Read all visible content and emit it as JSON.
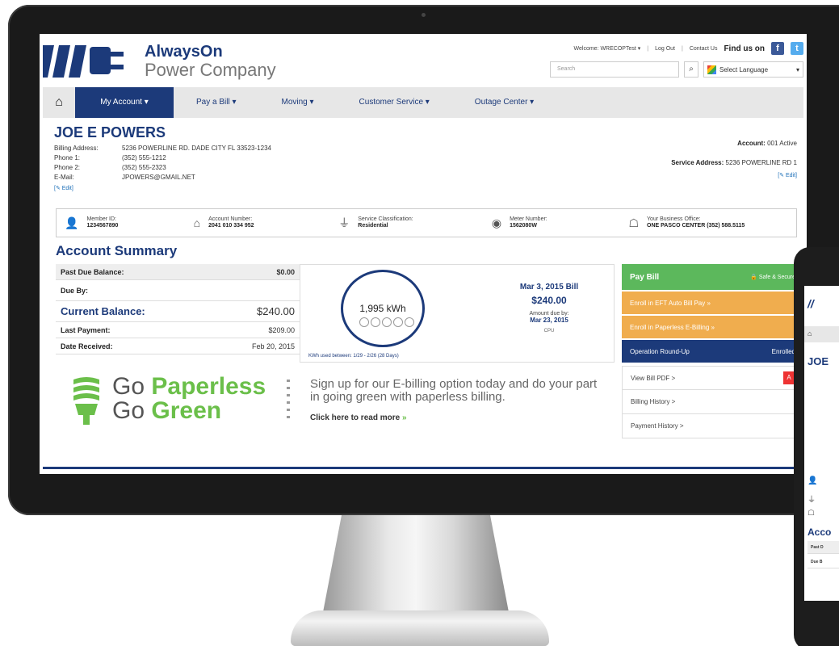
{
  "brand": {
    "name": "AlwaysOn",
    "sub": "Power Company"
  },
  "toplinks": {
    "welcome": "Welcome: WRECOPTest ▾",
    "logout": "Log Out",
    "contact": "Contact Us",
    "findus": "Find us on"
  },
  "search": {
    "placeholder": "Search"
  },
  "language": {
    "label": "Select Language"
  },
  "nav": {
    "items": [
      "My Account ▾",
      "Pay a Bill ▾",
      "Moving ▾",
      "Customer Service ▾",
      "Outage Center ▾"
    ]
  },
  "customer": {
    "name": "JOE E POWERS",
    "details": [
      {
        "label": "Billing Address:",
        "value": "5236 POWERLINE RD. DADE CITY FL 33523-1234"
      },
      {
        "label": "Phone 1:",
        "value": "(352) 555-1212"
      },
      {
        "label": "Phone 2:",
        "value": "(352) 555-2323"
      },
      {
        "label": "E-Mail:",
        "value": "JPOWERS@GMAIL.NET"
      }
    ],
    "edit": "[✎ Edit]",
    "account_label": "Account:",
    "account_value": "001 Active",
    "service_label": "Service Address:",
    "service_value": "5236 POWERLINE RD 1",
    "edit_right": "[✎ Edit]"
  },
  "info_strip": [
    {
      "icon": "person-icon",
      "glyph": "👤",
      "label": "Member ID:",
      "value": "1234567890"
    },
    {
      "icon": "house-icon",
      "glyph": "⌂",
      "label": "Account Number:",
      "value": "2041 010 334 952"
    },
    {
      "icon": "plug-icon",
      "glyph": "⏚",
      "label": "Service Classification:",
      "value": "Residential"
    },
    {
      "icon": "meter-icon",
      "glyph": "◉",
      "label": "Meter Number:",
      "value": "1562080W"
    },
    {
      "icon": "office-icon",
      "glyph": "☖",
      "label": "Your Business Office:",
      "value": "ONE PASCO CENTER (352) 588.5115"
    }
  ],
  "summary": {
    "title": "Account Summary",
    "rows": [
      {
        "label": "Past Due Balance:",
        "value": "$0.00",
        "style": "shade"
      },
      {
        "label": "Due By:",
        "value": "",
        "style": ""
      },
      {
        "label": "Current Balance:",
        "value": "$240.00",
        "style": "current"
      },
      {
        "label": "Last Payment:",
        "value": "$209.00",
        "style": ""
      },
      {
        "label": "Date Received:",
        "value": "Feb 20, 2015",
        "style": ""
      }
    ]
  },
  "usage": {
    "kwh": "1,995 kWh",
    "bill_date": "Mar 3, 2015 Bill",
    "bill_amount": "$240.00",
    "due_label": "Amount due by:",
    "due_date": "Mar 23, 2015",
    "cpu": "CPU",
    "range": "KWh used between: 1/29 - 2/26 (28 Days)"
  },
  "actions": {
    "pay": "Pay Bill",
    "secure": "🔒 Safe & Secure",
    "eft": "Enroll in EFT Auto Bill Pay »",
    "paperless": "Enroll in Paperless E-Billing »",
    "roundup": "Operation Round-Up",
    "roundup_status": "Enrolled",
    "view_pdf": "View Bill PDF >",
    "billing_history": "Billing History >",
    "payment_history": "Payment History >"
  },
  "promo": {
    "go1": "Go",
    "word1": "Paperless",
    "go2": "Go",
    "word2": "Green",
    "text": "Sign up for our E-billing option today and do your part in going green with paperless billing.",
    "link": "Click here to read more",
    "arrow": "»"
  },
  "phone": {
    "name": "JOE",
    "summary": "Acco",
    "rows": [
      "Past D",
      "Due B"
    ]
  },
  "colors": {
    "navy": "#1c3a7a",
    "green": "#5cb85c",
    "orange": "#f0ad4e"
  }
}
